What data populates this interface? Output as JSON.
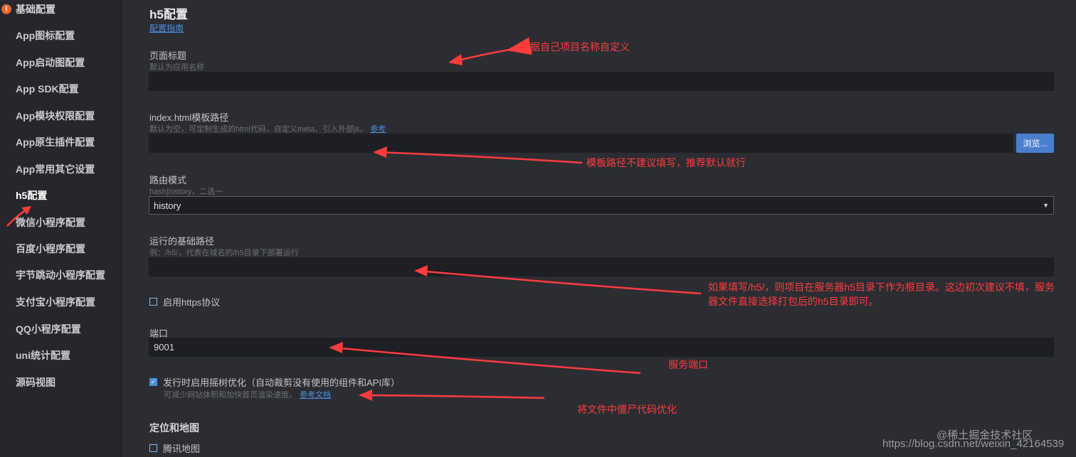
{
  "sidebar": {
    "header": "基础配置",
    "items": [
      {
        "label": "App图标配置"
      },
      {
        "label": "App启动图配置"
      },
      {
        "label": "App SDK配置"
      },
      {
        "label": "App模块权限配置"
      },
      {
        "label": "App原生插件配置"
      },
      {
        "label": "App常用其它设置"
      },
      {
        "label": "h5配置"
      },
      {
        "label": "微信小程序配置"
      },
      {
        "label": "百度小程序配置"
      },
      {
        "label": "宇节跳动小程序配置"
      },
      {
        "label": "支付宝小程序配置"
      },
      {
        "label": "QQ小程序配置"
      },
      {
        "label": "uni统计配置"
      },
      {
        "label": "源码视图"
      }
    ]
  },
  "main": {
    "title": "h5配置",
    "guide_link": "配置指南",
    "page_title_field": {
      "label": "页面标题",
      "hint": "默认为应用名称",
      "value": ""
    },
    "template_field": {
      "label": "index.html模板路径",
      "hint": "默认为空，可定制生成的html代码，自定义meta、引入外部js，",
      "hint_link": "参考",
      "value": "",
      "browse": "浏览..."
    },
    "router_field": {
      "label": "路由模式",
      "hint": "hash|history，二选一",
      "value": "history"
    },
    "base_path_field": {
      "label": "运行的基础路径",
      "hint": "例：/h5/，代表在域名的/h5目录下部署运行",
      "value": ""
    },
    "https_checkbox": {
      "label": "启用https协议",
      "checked": false
    },
    "port_field": {
      "label": "端口",
      "value": "9001"
    },
    "treeshake_checkbox": {
      "label": "发行时启用摇树优化（自动裁剪没有使用的组件和API库）",
      "checked": true,
      "hint": "可减少网站体积和加快首页渲染速度。",
      "hint_link": "参考文档"
    },
    "map_section": {
      "title": "定位和地图",
      "tencent_map": {
        "label": "腾讯地图",
        "checked": false
      }
    }
  },
  "annotations": {
    "note1": "根据自己项目名称自定义",
    "note2": "模板路径不建议填写，推荐默认就行",
    "note3": "如果填写/h5/，则项目在服务器h5目录下作为根目录。这边初次建议不填，服务器文件直接选择打包后的h5目录即可。",
    "note4": "服务端口",
    "note5": "将文件中僵尸代码优化",
    "color": "#ff3b3b"
  },
  "watermark": {
    "line1": "@稀土掘金技术社区",
    "line2": "https://blog.csdn.net/weixin_42164539"
  }
}
